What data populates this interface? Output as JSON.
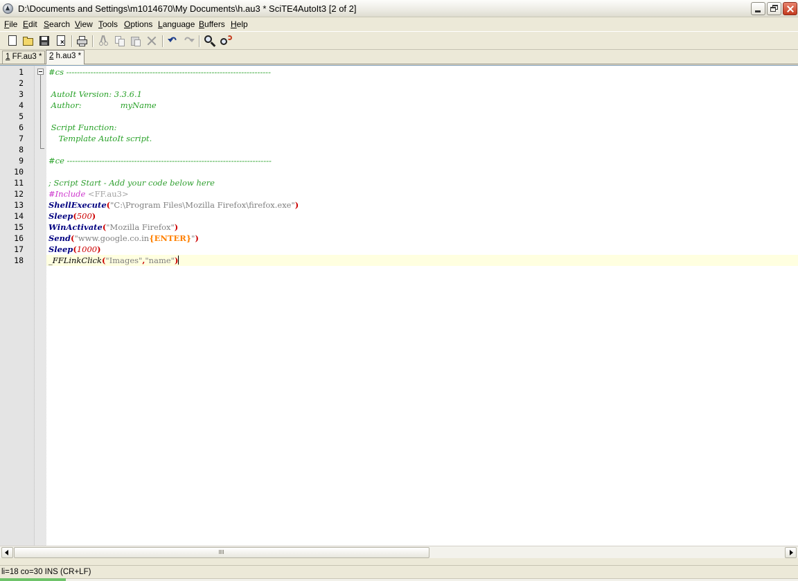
{
  "window": {
    "title": "D:\\Documents and Settings\\m1014670\\My Documents\\h.au3 * SciTE4AutoIt3 [2 of 2]"
  },
  "menu": [
    {
      "pre": "",
      "u": "F",
      "post": "ile"
    },
    {
      "pre": "",
      "u": "E",
      "post": "dit"
    },
    {
      "pre": "",
      "u": "S",
      "post": "earch"
    },
    {
      "pre": "",
      "u": "V",
      "post": "iew"
    },
    {
      "pre": "",
      "u": "T",
      "post": "ools"
    },
    {
      "pre": "",
      "u": "O",
      "post": "ptions"
    },
    {
      "pre": "",
      "u": "L",
      "post": "anguage"
    },
    {
      "pre": "",
      "u": "B",
      "post": "uffers"
    },
    {
      "pre": "",
      "u": "H",
      "post": "elp"
    }
  ],
  "toolbar_icons": [
    "new-file-icon",
    "open-folder-icon",
    "save-icon",
    "close-file-icon",
    "print-icon",
    "cut-icon",
    "copy-icon",
    "paste-icon",
    "delete-icon",
    "undo-icon",
    "redo-icon",
    "find-icon",
    "replace-icon"
  ],
  "tabs": [
    {
      "num": "1",
      "label": " FF.au3 *",
      "active": false
    },
    {
      "num": "2",
      "label": " h.au3 *",
      "active": true
    }
  ],
  "editor": {
    "line_numbers": [
      "1",
      "2",
      "3",
      "4",
      "5",
      "6",
      "7",
      "8",
      "9",
      "10",
      "11",
      "12",
      "13",
      "14",
      "15",
      "16",
      "17",
      "18"
    ],
    "lines": {
      "l1": "#cs ----------------------------------------------------------------------------",
      "l3": " AutoIt Version: 3.3.6.1",
      "l4a": " Author:",
      "l4b": "myName",
      "l6": " Script Function:",
      "l7": "    Template AutoIt script.",
      "l9": "#ce ----------------------------------------------------------------------------",
      "l11": "; Script Start - Add your code below here",
      "l12a": "#Include",
      "l12b": " <FF.au3>",
      "l13fn": "ShellExecute",
      "l13str": "\"C:\\Program Files\\Mozilla Firefox\\firefox.exe\"",
      "l14fn": "Sleep",
      "l14num": "500",
      "l15fn": "WinActivate",
      "l15str": "\"Mozilla Firefox\"",
      "l16fn": "Send",
      "l16str1": "\"www.google.co.in",
      "l16send": "{ENTER}",
      "l16str2": "\"",
      "l17fn": "Sleep",
      "l17num": "1000",
      "l18fn": "_FFLinkClick",
      "l18str1": "\"Images\"",
      "l18comma": ",",
      "l18str2": "\"name\""
    },
    "paren_open": "(",
    "paren_close": ")"
  },
  "status": {
    "text": "li=18 co=30 INS (CR+LF)"
  }
}
